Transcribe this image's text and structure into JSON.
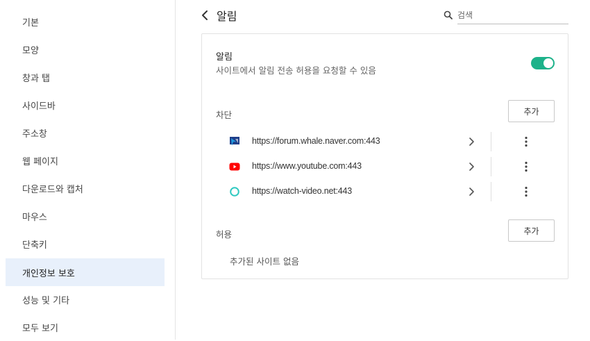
{
  "sidebar": {
    "items": [
      {
        "label": "기본"
      },
      {
        "label": "모양"
      },
      {
        "label": "창과 탭"
      },
      {
        "label": "사이드바"
      },
      {
        "label": "주소창"
      },
      {
        "label": "웹 페이지"
      },
      {
        "label": "다운로드와 캡처"
      },
      {
        "label": "마우스"
      },
      {
        "label": "단축키"
      },
      {
        "label": "개인정보 보호"
      },
      {
        "label": "성능 및 기타"
      },
      {
        "label": "모두 보기"
      }
    ],
    "active_index": 9
  },
  "header": {
    "title": "알림",
    "back_icon": "chevron-left-icon",
    "search_placeholder": "검색",
    "search_value": ""
  },
  "notification": {
    "title": "알림",
    "description": "사이트에서 알림 전송 허용을 요청할 수 있음",
    "enabled": true
  },
  "blocked": {
    "label": "차단",
    "add_label": "추가",
    "sites": [
      {
        "url": "https://forum.whale.naver.com:443",
        "icon": "whale-forum-favicon"
      },
      {
        "url": "https://www.youtube.com:443",
        "icon": "youtube-favicon"
      },
      {
        "url": "https://watch-video.net:443",
        "icon": "circle-favicon"
      }
    ]
  },
  "allowed": {
    "label": "허용",
    "add_label": "추가",
    "empty_text": "추가된 사이트 없음"
  },
  "colors": {
    "accent": "#1db28a",
    "active_bg": "#e8f0fb",
    "youtube_red": "#ff0000",
    "whale_blue": "#1f3f8a"
  }
}
